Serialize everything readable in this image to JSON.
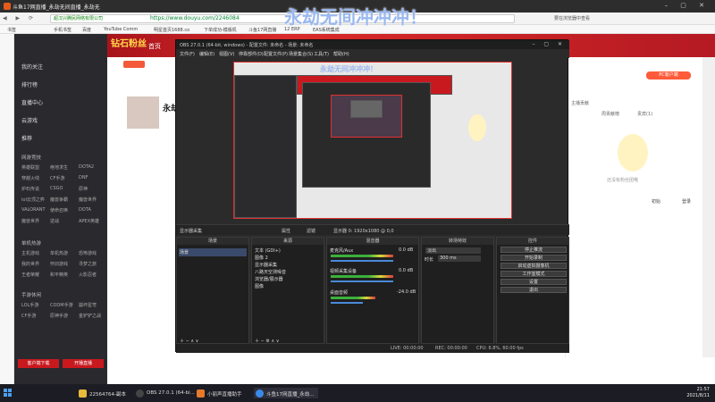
{
  "browser": {
    "tab_title": "斗鱼17网直播_永劫无间直播_永劫无",
    "secure_label": "超汉兴腾民网络有限公司",
    "url": "https://www.douyu.com/2246084",
    "right_hint": "要在浏览器中查看",
    "bookmarks": [
      "书签",
      "手机书签",
      "百度",
      "YouTube Comm",
      "明星首页1688.co",
      "下单成功-模版机",
      "斗鱼17网直播",
      "12 ERP",
      "EAS系统集成"
    ]
  },
  "overlay_text": "永劫无间冲冲冲！",
  "site": {
    "logo": "钻石粉丝",
    "home": "首页",
    "sidebar": {
      "items": [
        "我的关注",
        "排行榜",
        "直播中心",
        "云游戏",
        "推荐"
      ],
      "sections": [
        "网游竞技",
        "单机热游",
        "手游休闲"
      ],
      "grid": [
        [
          "英雄联盟",
          "绝地求生",
          "DOTA2"
        ],
        [
          "穿越火线",
          "CF手游",
          "DNF"
        ],
        [
          "炉石传说",
          "CSGO",
          "原神"
        ],
        [
          "lol云顶之弈",
          "魔兽争霸",
          "魔兽世界"
        ],
        [
          "VALORANT",
          "使命召唤",
          "DOTA"
        ],
        [
          "魔兽世界",
          "逆战",
          "APEX英雄"
        ],
        [
          "主机游戏",
          "单机热游",
          "恐怖游戏"
        ],
        [
          "我的世界",
          "怀旧游戏",
          "寻梦之旅"
        ],
        [
          "王者荣耀",
          "和平精英",
          "火影忍者"
        ],
        [
          "LOL手游",
          "CODM手游",
          "崩坏星穹"
        ],
        [
          "CF手游",
          "原神手游",
          "金铲铲之战"
        ]
      ],
      "buttons": [
        "客户端下载",
        "开播直播"
      ]
    },
    "streamer_name": "永劫",
    "right": {
      "pc_client": "PC客户端",
      "tabs": [
        "主播贡献",
        "周贡献榜",
        "贵宾(1)"
      ],
      "empty_text": "还没有粉丝团哦",
      "actions": [
        "初始",
        "登录"
      ]
    }
  },
  "obs": {
    "title": "OBS 27.0.1 (64-bit, windows) - 配置文件: 未命名 - 场景: 未命名",
    "menu": [
      "文件(F)",
      "编辑(E)",
      "视图(V)",
      "停靠部件(D)",
      "配置文件(P)",
      "场景集合(S)",
      "工具(T)",
      "帮助(H)"
    ],
    "preview_title": "永劫无间冲冲冲！",
    "bar_items": [
      "显示器采集",
      "属性",
      "滤镜",
      "显示器 0: 1920x1080 @ 0,0"
    ],
    "docks": {
      "scenes": {
        "title": "场景",
        "items": [
          "场景"
        ]
      },
      "sources": {
        "title": "来源",
        "items": [
          "文本 (GDI+)",
          "图像 2",
          "显示器采集",
          "八路天空测噪音",
          "浏览器/展示器",
          "图像"
        ]
      },
      "mixer": {
        "title": "混音器",
        "channels": [
          {
            "name": "麦克风/Aux",
            "db": "0.0 dB"
          },
          {
            "name": "视频采集设备",
            "db": "0.0 dB"
          },
          {
            "name": "桌面音频",
            "db": "-24.0 dB"
          }
        ]
      },
      "transitions": {
        "title": "转场特效",
        "type": "淡出",
        "duration_label": "时长",
        "duration": "300 ms"
      },
      "controls": {
        "title": "控件",
        "buttons": [
          "停止推流",
          "开始录制",
          "启动虚拟摄像机",
          "工作室模式",
          "设置",
          "退出"
        ]
      }
    },
    "status": [
      "LIVE: 00:00:00",
      "REC: 00:00:00",
      "CPU: 6.8%, 60.00 fps"
    ]
  },
  "taskbar": {
    "items": [
      "22564764-副本",
      "OBS 27.0.1 (64-bi...",
      "小丽声直播助手",
      "斗鱼17网直播_永劫..."
    ],
    "time": "21:57",
    "date": "2021/8/11"
  },
  "colors": {
    "brand_red": "#c8191f",
    "obs_bg": "#2b2b2b",
    "accent_blue": "#4aa0f0"
  }
}
